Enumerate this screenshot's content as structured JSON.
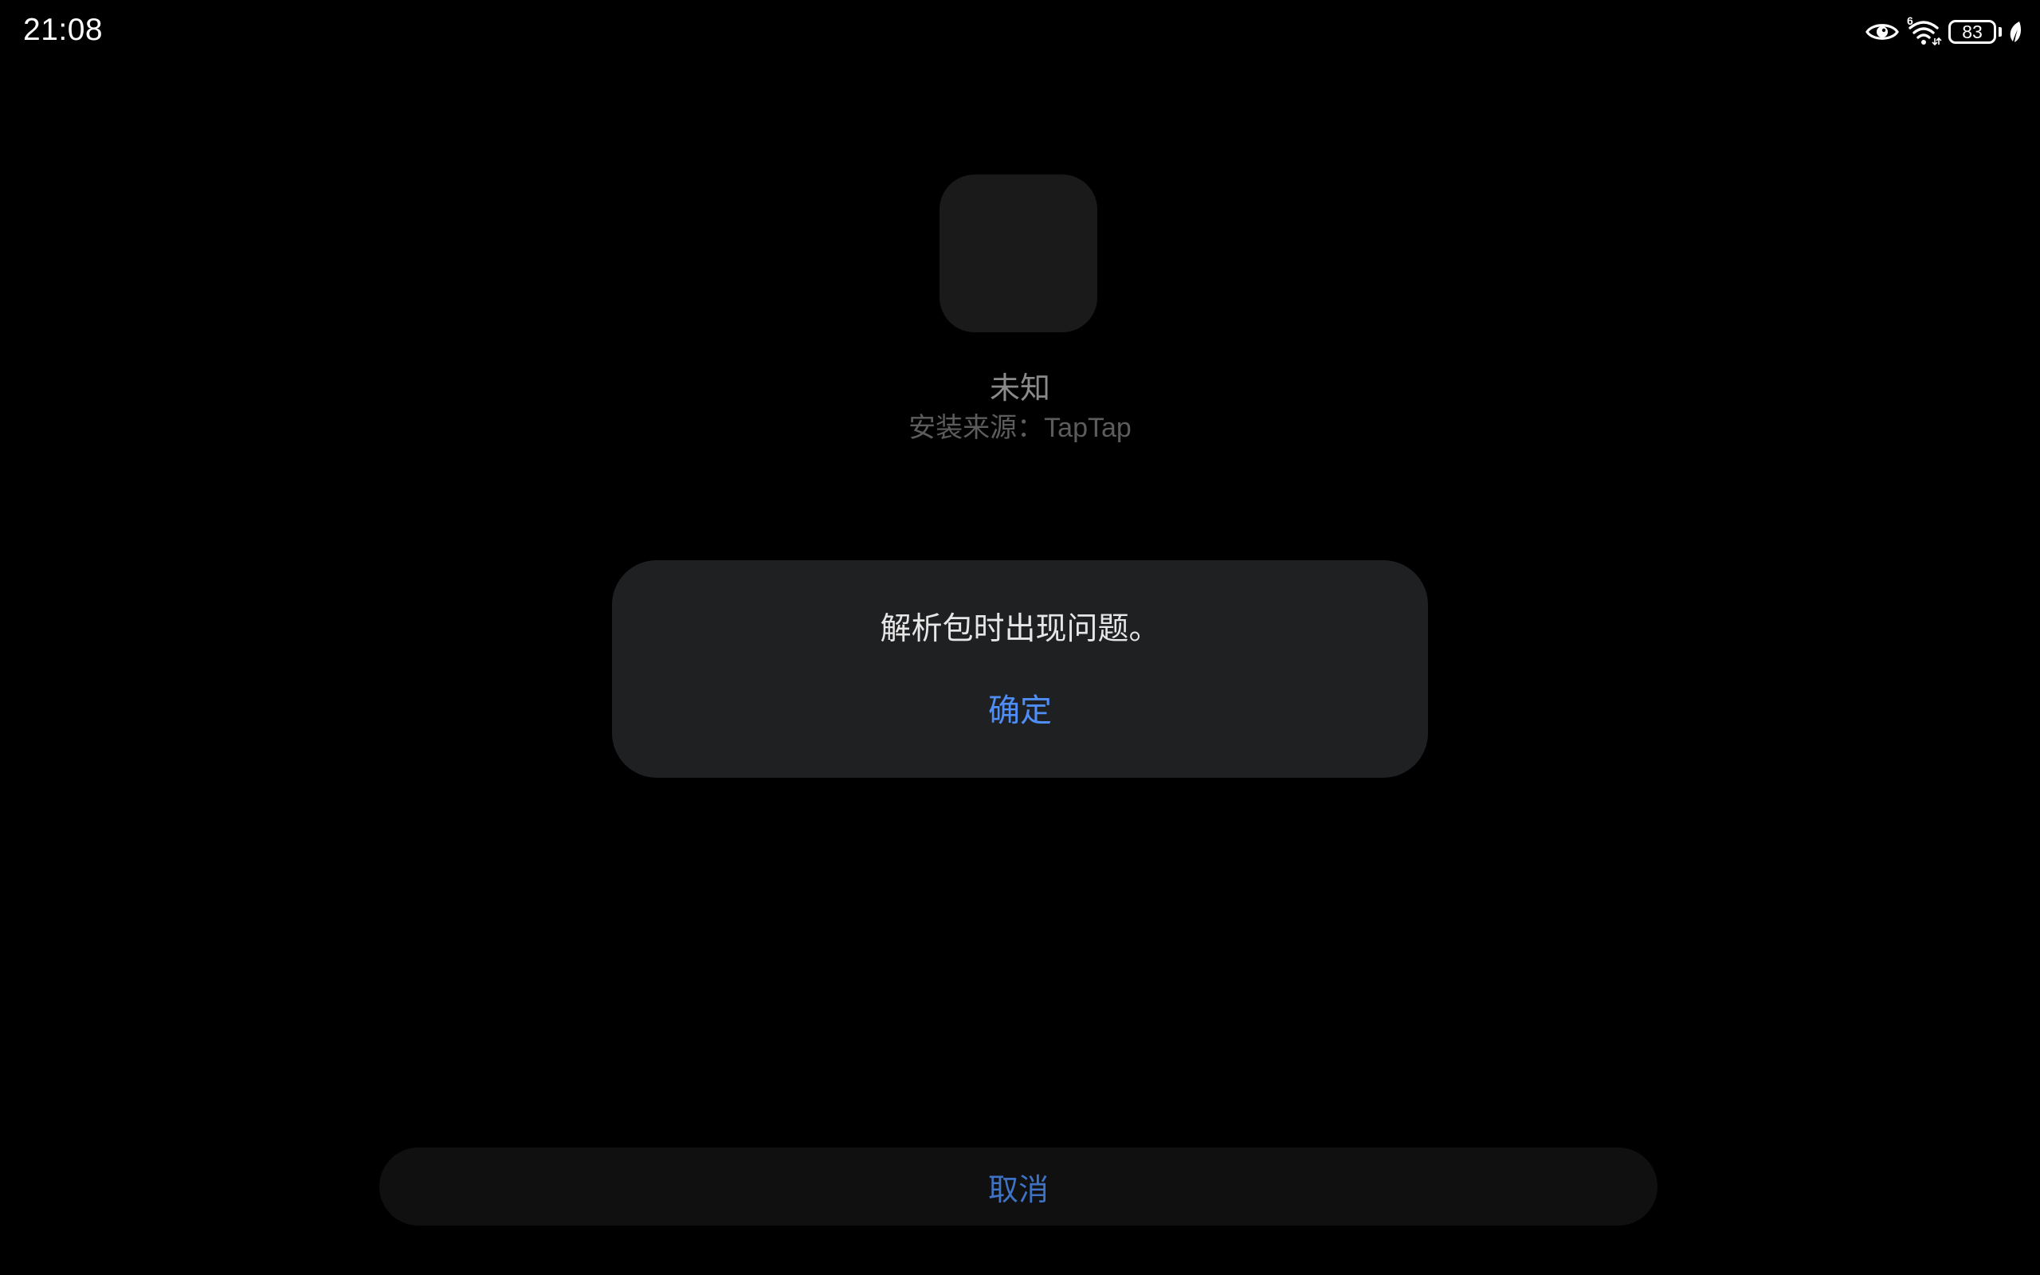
{
  "status_bar": {
    "time": "21:08",
    "signal_label": "6",
    "battery_level": "83",
    "icons": [
      "eye-icon",
      "wifi-icon",
      "battery-icon",
      "leaf-icon"
    ]
  },
  "app": {
    "name": "未知",
    "install_source_label": "安装来源：",
    "install_source_value": "TapTap"
  },
  "dialog": {
    "message": "解析包时出现问题。",
    "ok_label": "确定"
  },
  "footer": {
    "cancel_label": "取消"
  },
  "colors": {
    "background": "#000000",
    "dialog_bg": "#1f2022",
    "accent": "#4f8ef7",
    "cancel_text": "#3f72c4"
  }
}
